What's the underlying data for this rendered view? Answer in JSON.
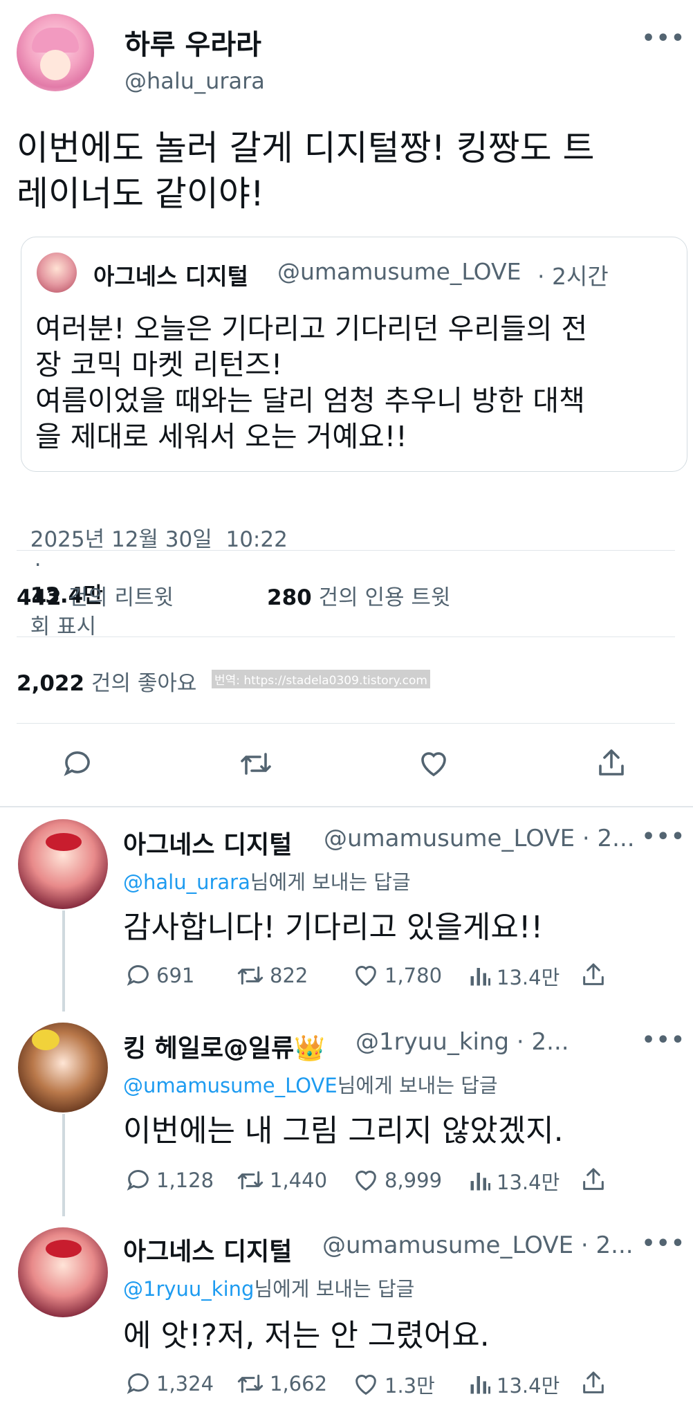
{
  "main_tweet": {
    "display_name": "하루 우라라",
    "handle": "@halu_urara",
    "text_line1": "이번에도 놀러 갈게 디지털짱! 킹짱도 트",
    "text_line2": "레이너도 같이야!",
    "quote": {
      "display_name": "아그네스 디지털",
      "handle": "@umamusume_LOVE",
      "time": "· 2시간",
      "lines": [
        "여러분! 오늘은 기다리고 기다리던 우리들의 전",
        "장 코믹 마켓 리턴즈!",
        "여름이었을 때와는 달리 엄청 추우니 방한 대책",
        "을 제대로 세워서 오는 거예요!!"
      ]
    },
    "date": "2025년 12월 30일  10:22",
    "views_sep": "·",
    "views": "13.4만",
    "views_label": "회 표시",
    "retweets": "442",
    "retweets_label": "건의 리트윗",
    "quotes": "280",
    "quotes_label": "건의 인용 트윗",
    "likes": "2,022",
    "likes_label": "건의 좋아요",
    "watermark": "번역: https://stadela0309.tistory.com"
  },
  "replies": [
    {
      "display_name": "아그네스 디지털",
      "handle": "@umamusume_LOVE · 2...",
      "reply_to": "@halu_urara",
      "reply_suffix": "님에게 보내는 답글",
      "text": "감사합니다! 기다리고 있을게요!!",
      "comments": "691",
      "retweets": "822",
      "likes": "1,780",
      "views": "13.4만"
    },
    {
      "display_name": "킹 헤일로@일류",
      "badge": "👑",
      "handle": "@1ryuu_king · 2...",
      "reply_to": "@umamusume_LOVE",
      "reply_suffix": "님에게 보내는 답글",
      "text": "이번에는 내 그림 그리지 않았겠지.",
      "comments": "1,128",
      "retweets": "1,440",
      "likes": "8,999",
      "views": "13.4만"
    },
    {
      "display_name": "아그네스 디지털",
      "handle": "@umamusume_LOVE · 2...",
      "reply_to": "@1ryuu_king",
      "reply_suffix": "님에게 보내는 답글",
      "text": "에 앗!?저, 저는 안 그렸어요.",
      "comments": "1,324",
      "retweets": "1,662",
      "likes": "1.3만",
      "views": "13.4만"
    }
  ],
  "colors": {
    "link": "#1d9bf0",
    "muted": "#536471",
    "divider": "#e1e6ea"
  }
}
